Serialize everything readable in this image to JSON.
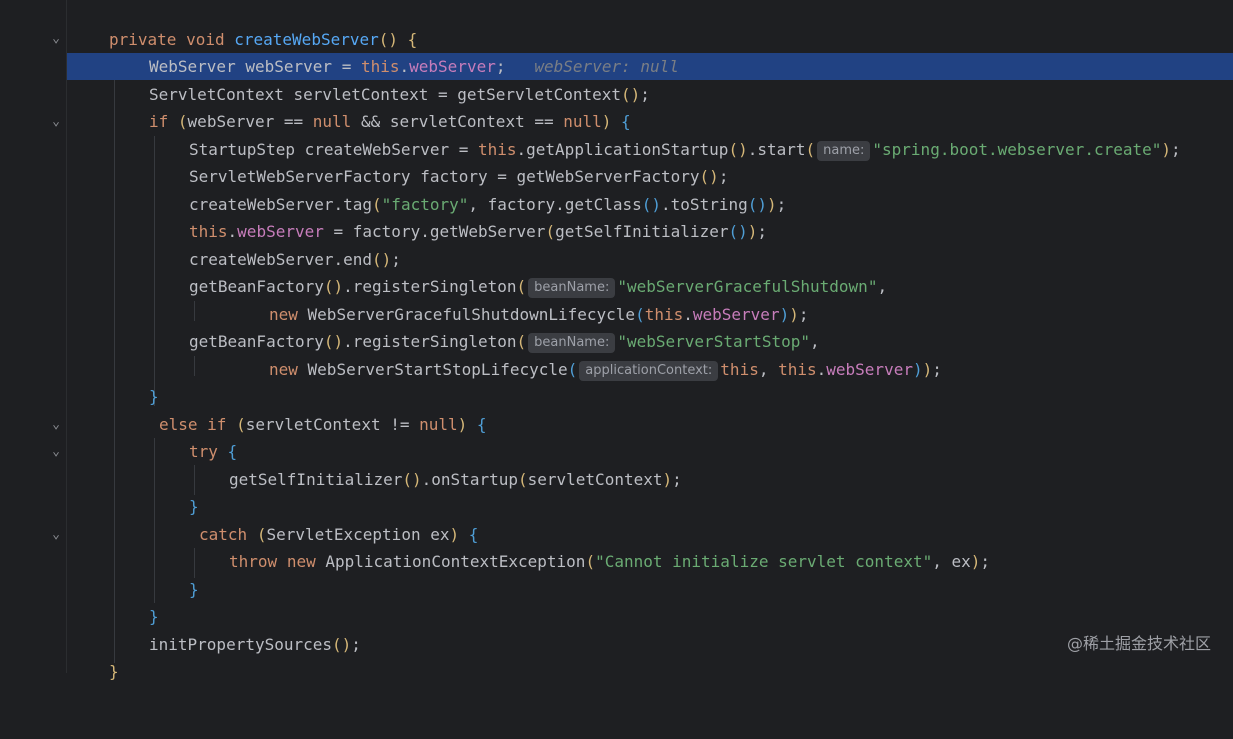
{
  "editor": {
    "signature": {
      "kw1": "private",
      "kw2": "void",
      "name": "createWebServer",
      "paren": "()",
      "brace": "{"
    },
    "line1": {
      "type": "WebServer",
      "var": "webServer",
      "eq": "=",
      "this_kw": "this",
      "dot": ".",
      "field": "webServer",
      "semi": ";",
      "debug": "webServer: null"
    },
    "line2": {
      "text_a": "ServletContext servletContext = ",
      "call": "getServletContext",
      "paren": "()",
      "semi": ";"
    },
    "line3": {
      "kw_if": "if",
      "open": "(",
      "text_a": "webServer == ",
      "null1": "null",
      "text_b": " && servletContext == ",
      "null2": "null",
      "close": ")",
      "brace": "{"
    },
    "line4": {
      "text_a": "StartupStep createWebServer = ",
      "this_kw": "this",
      "text_b": ".getApplicationStartup",
      "paren": "()",
      "text_c": ".start",
      "open": "(",
      "hint": "name:",
      "str": "\"spring.boot.webserver.create\"",
      "close": ")",
      "semi": ";"
    },
    "line5": {
      "text_a": "ServletWebServerFactory factory = getWebServerFactory",
      "paren": "()",
      "semi": ";"
    },
    "line6": {
      "text_a": "createWebServer.tag",
      "open": "(",
      "str": "\"factory\"",
      "text_b": ", factory.getClass",
      "paren1": "()",
      "text_c": ".toString",
      "paren2": "()",
      "close": ")",
      "semi": ";"
    },
    "line7": {
      "this_kw": "this",
      "dot": ".",
      "field": "webServer",
      "text_a": " = factory.getWebServer",
      "open": "(",
      "text_b": "getSelfInitializer",
      "paren": "()",
      "close": ")",
      "semi": ";"
    },
    "line8": {
      "text_a": "createWebServer.end",
      "paren": "()",
      "semi": ";"
    },
    "line9": {
      "text_a": "getBeanFactory",
      "paren": "()",
      "text_b": ".registerSingleton",
      "open": "(",
      "hint": "beanName:",
      "str": "\"webServerGracefulShutdown\"",
      "comma": ","
    },
    "line10": {
      "kw_new": "new",
      "text_a": " WebServerGracefulShutdownLifecycle",
      "open": "(",
      "this_kw": "this",
      "dot": ".",
      "field": "webServer",
      "close": ")",
      "close2": ")",
      "semi": ";"
    },
    "line11": {
      "text_a": "getBeanFactory",
      "paren": "()",
      "text_b": ".registerSingleton",
      "open": "(",
      "hint": "beanName:",
      "str": "\"webServerStartStop\"",
      "comma": ","
    },
    "line12": {
      "kw_new": "new",
      "text_a": " WebServerStartStopLifecycle",
      "open": "(",
      "hint": "applicationContext:",
      "this1": "this",
      "comma": ", ",
      "this2": "this",
      "dot": ".",
      "field": "webServer",
      "close": ")",
      "close2": ")",
      "semi": ";"
    },
    "line13": {
      "brace": "}"
    },
    "line14": {
      "kw_else": "else",
      "kw_if": "if",
      "open": "(",
      "text_a": "servletContext != ",
      "null1": "null",
      "close": ")",
      "brace": "{"
    },
    "line15": {
      "kw_try": "try",
      "brace": "{"
    },
    "line16": {
      "text_a": "getSelfInitializer",
      "paren": "()",
      "text_b": ".onStartup",
      "open": "(",
      "text_c": "servletContext",
      "close": ")",
      "semi": ";"
    },
    "line17": {
      "brace": "}"
    },
    "line18": {
      "kw_catch": "catch",
      "open": "(",
      "text_a": "ServletException ex",
      "close": ")",
      "brace": "{"
    },
    "line19": {
      "kw_throw": "throw",
      "kw_new": "new",
      "text_a": " ApplicationContextException",
      "open": "(",
      "str": "\"Cannot initialize servlet context\"",
      "text_b": ", ex",
      "close": ")",
      "semi": ";"
    },
    "line20": {
      "brace": "}"
    },
    "line21": {
      "brace": "}"
    },
    "line22": {
      "text_a": "initPropertySources",
      "paren": "()",
      "semi": ";"
    },
    "line23": {
      "brace": "}"
    }
  },
  "watermark": "@稀土掘金技术社区",
  "colors": {
    "background": "#1e1f22",
    "highlight": "#214283",
    "keyword": "#cf8e6d",
    "method": "#56a8f5",
    "field": "#c77dbb",
    "string": "#6aab73"
  },
  "icons": {
    "fold": "chevron-down-icon"
  }
}
